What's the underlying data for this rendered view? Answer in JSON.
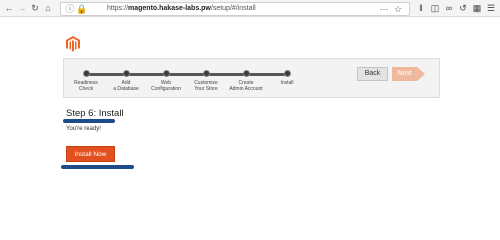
{
  "browser": {
    "url_scheme": "https://",
    "url_host": "magento.hakase-labs.pw",
    "url_path": "/setup/#/install",
    "icons": {
      "back": "back-arrow-icon",
      "forward": "forward-arrow-icon",
      "reload": "reload-icon",
      "home": "home-icon",
      "info": "info-icon",
      "lock": "lock-icon",
      "more": "more-dots-icon",
      "bookmark": "star-icon"
    }
  },
  "logo": {
    "icon": "magento-logo-icon",
    "color": "#f26322"
  },
  "wizard": {
    "steps": [
      {
        "line1": "Readiness",
        "line2": "Check"
      },
      {
        "line1": "Add",
        "line2": "a Database"
      },
      {
        "line1": "Web",
        "line2": "Configuration"
      },
      {
        "line1": "Customize",
        "line2": "Your Store"
      },
      {
        "line1": "Create",
        "line2": "Admin Account"
      },
      {
        "line1": "Install",
        "line2": ""
      }
    ],
    "back_label": "Back",
    "next_label": "Next"
  },
  "main": {
    "title": "Step 6: Install",
    "ready_text": "You're ready!",
    "install_label": "Install Now"
  },
  "colors": {
    "accent": "#e3501f",
    "next_disabled": "#f0b89c",
    "highlight": "#1d4c8c"
  }
}
